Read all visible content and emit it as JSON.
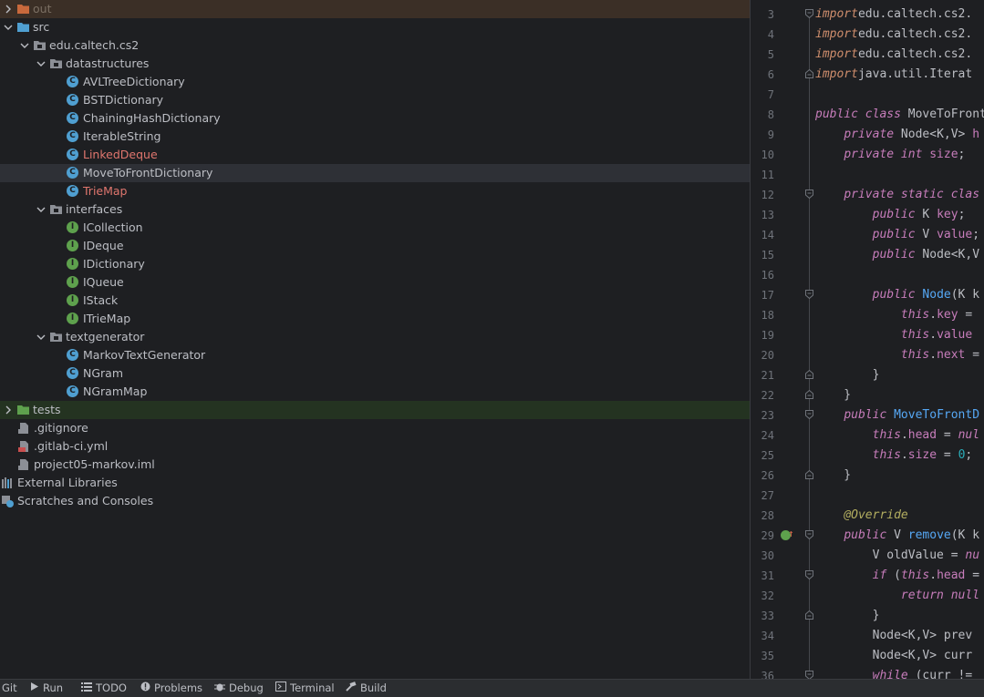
{
  "tree": {
    "items": [
      {
        "label": "out",
        "indent": 0,
        "kind": "folder-orange",
        "chevron": "right",
        "style": "muted",
        "highlight": "out"
      },
      {
        "label": "src",
        "indent": 0,
        "kind": "folder-blue",
        "chevron": "down"
      },
      {
        "label": "edu.caltech.cs2",
        "indent": 1,
        "kind": "package",
        "chevron": "down"
      },
      {
        "label": "datastructures",
        "indent": 2,
        "kind": "package",
        "chevron": "down"
      },
      {
        "label": "AVLTreeDictionary",
        "indent": 3,
        "kind": "class"
      },
      {
        "label": "BSTDictionary",
        "indent": 3,
        "kind": "class"
      },
      {
        "label": "ChainingHashDictionary",
        "indent": 3,
        "kind": "class"
      },
      {
        "label": "IterableString",
        "indent": 3,
        "kind": "class"
      },
      {
        "label": "LinkedDeque",
        "indent": 3,
        "kind": "class",
        "style": "red"
      },
      {
        "label": "MoveToFrontDictionary",
        "indent": 3,
        "kind": "class",
        "highlight": "sel"
      },
      {
        "label": "TrieMap",
        "indent": 3,
        "kind": "class",
        "style": "red"
      },
      {
        "label": "interfaces",
        "indent": 2,
        "kind": "package",
        "chevron": "down"
      },
      {
        "label": "ICollection",
        "indent": 3,
        "kind": "interface"
      },
      {
        "label": "IDeque",
        "indent": 3,
        "kind": "interface"
      },
      {
        "label": "IDictionary",
        "indent": 3,
        "kind": "interface"
      },
      {
        "label": "IQueue",
        "indent": 3,
        "kind": "interface"
      },
      {
        "label": "IStack",
        "indent": 3,
        "kind": "interface"
      },
      {
        "label": "ITrieMap",
        "indent": 3,
        "kind": "interface"
      },
      {
        "label": "textgenerator",
        "indent": 2,
        "kind": "package",
        "chevron": "down"
      },
      {
        "label": "MarkovTextGenerator",
        "indent": 3,
        "kind": "class-main"
      },
      {
        "label": "NGram",
        "indent": 3,
        "kind": "class"
      },
      {
        "label": "NGramMap",
        "indent": 3,
        "kind": "class"
      },
      {
        "label": "tests",
        "indent": 0,
        "kind": "folder-green",
        "chevron": "right",
        "highlight": "tests"
      },
      {
        "label": ".gitignore",
        "indent": 1,
        "kind": "file-git"
      },
      {
        "label": ".gitlab-ci.yml",
        "indent": 1,
        "kind": "file-yml"
      },
      {
        "label": "project05-markov.iml",
        "indent": 1,
        "kind": "file-iml"
      },
      {
        "label": "External Libraries",
        "indent": 0,
        "kind": "libraries",
        "flush": true
      },
      {
        "label": "Scratches and Consoles",
        "indent": 0,
        "kind": "scratches",
        "flush": true
      }
    ]
  },
  "editor": {
    "lines": [
      {
        "n": "3",
        "fold": "open",
        "html": [
          [
            "kwi",
            "import"
          ],
          [
            "",
            "edu.caltech.cs2."
          ]
        ]
      },
      {
        "n": "4",
        "html": [
          [
            "kwi",
            "import"
          ],
          [
            "",
            "edu.caltech.cs2."
          ]
        ]
      },
      {
        "n": "5",
        "html": [
          [
            "kwi",
            "import"
          ],
          [
            "",
            "edu.caltech.cs2."
          ]
        ]
      },
      {
        "n": "6",
        "fold": "close",
        "html": [
          [
            "kwi",
            "import"
          ],
          [
            "",
            "java.util.Iterat"
          ]
        ]
      },
      {
        "n": "7",
        "html": []
      },
      {
        "n": "8",
        "html": [
          [
            "kwp",
            "public class"
          ],
          [
            "",
            " MoveToFront"
          ]
        ]
      },
      {
        "n": "9",
        "html": [
          [
            "",
            "    "
          ],
          [
            "kwp",
            "private"
          ],
          [
            "",
            " Node<K,V> "
          ],
          [
            "fld",
            "h"
          ]
        ]
      },
      {
        "n": "10",
        "html": [
          [
            "",
            "    "
          ],
          [
            "kwp",
            "private int"
          ],
          [
            "",
            " "
          ],
          [
            "fld",
            "size"
          ],
          [
            "",
            ";"
          ]
        ]
      },
      {
        "n": "11",
        "html": []
      },
      {
        "n": "12",
        "fold": "open",
        "html": [
          [
            "",
            "    "
          ],
          [
            "kwp",
            "private static clas"
          ]
        ]
      },
      {
        "n": "13",
        "html": [
          [
            "",
            "        "
          ],
          [
            "kwp",
            "public"
          ],
          [
            "",
            " K "
          ],
          [
            "fld",
            "key"
          ],
          [
            "",
            ";"
          ]
        ]
      },
      {
        "n": "14",
        "html": [
          [
            "",
            "        "
          ],
          [
            "kwp",
            "public"
          ],
          [
            "",
            " V "
          ],
          [
            "fld",
            "value"
          ],
          [
            "",
            ";"
          ]
        ]
      },
      {
        "n": "15",
        "html": [
          [
            "",
            "        "
          ],
          [
            "kwp",
            "public"
          ],
          [
            "",
            " Node<K,V"
          ]
        ]
      },
      {
        "n": "16",
        "html": []
      },
      {
        "n": "17",
        "fold": "open",
        "html": [
          [
            "",
            "        "
          ],
          [
            "kwp",
            "public"
          ],
          [
            "",
            " "
          ],
          [
            "fn",
            "Node"
          ],
          [
            "",
            "(K k"
          ]
        ]
      },
      {
        "n": "18",
        "html": [
          [
            "",
            "            "
          ],
          [
            "kwp",
            "this"
          ],
          [
            "",
            "."
          ],
          [
            "fld",
            "key"
          ],
          [
            "",
            " ="
          ]
        ]
      },
      {
        "n": "19",
        "html": [
          [
            "",
            "            "
          ],
          [
            "kwp",
            "this"
          ],
          [
            "",
            "."
          ],
          [
            "fld",
            "value"
          ]
        ]
      },
      {
        "n": "20",
        "html": [
          [
            "",
            "            "
          ],
          [
            "kwp",
            "this"
          ],
          [
            "",
            "."
          ],
          [
            "fld",
            "next"
          ],
          [
            "",
            " ="
          ]
        ]
      },
      {
        "n": "21",
        "fold": "close",
        "html": [
          [
            "",
            "        }"
          ]
        ]
      },
      {
        "n": "22",
        "fold": "close",
        "html": [
          [
            "",
            "    }"
          ]
        ]
      },
      {
        "n": "23",
        "fold": "open",
        "html": [
          [
            "",
            "    "
          ],
          [
            "kwp",
            "public"
          ],
          [
            "",
            " "
          ],
          [
            "fn",
            "MoveToFrontD"
          ]
        ]
      },
      {
        "n": "24",
        "html": [
          [
            "",
            "        "
          ],
          [
            "kwp",
            "this"
          ],
          [
            "",
            "."
          ],
          [
            "fld",
            "head"
          ],
          [
            "",
            " = "
          ],
          [
            "kwp",
            "nul"
          ]
        ]
      },
      {
        "n": "25",
        "html": [
          [
            "",
            "        "
          ],
          [
            "kwp",
            "this"
          ],
          [
            "",
            "."
          ],
          [
            "fld",
            "size"
          ],
          [
            "",
            " = "
          ],
          [
            "num",
            "0"
          ],
          [
            "",
            ";"
          ]
        ]
      },
      {
        "n": "26",
        "fold": "close",
        "html": [
          [
            "",
            "    }"
          ]
        ]
      },
      {
        "n": "27",
        "html": []
      },
      {
        "n": "28",
        "html": [
          [
            "",
            "    "
          ],
          [
            "an",
            "@Override"
          ]
        ]
      },
      {
        "n": "29",
        "fold": "open",
        "marker": true,
        "html": [
          [
            "",
            "    "
          ],
          [
            "kwp",
            "public"
          ],
          [
            "",
            " V "
          ],
          [
            "fn",
            "remove"
          ],
          [
            "",
            "(K k"
          ]
        ]
      },
      {
        "n": "30",
        "html": [
          [
            "",
            "        V oldValue = "
          ],
          [
            "kwp",
            "nu"
          ]
        ]
      },
      {
        "n": "31",
        "fold": "open",
        "html": [
          [
            "",
            "        "
          ],
          [
            "kwp",
            "if"
          ],
          [
            "",
            " ("
          ],
          [
            "kwp",
            "this"
          ],
          [
            "",
            "."
          ],
          [
            "fld",
            "head"
          ],
          [
            "",
            " ="
          ]
        ]
      },
      {
        "n": "32",
        "html": [
          [
            "",
            "            "
          ],
          [
            "kwp",
            "return null"
          ]
        ]
      },
      {
        "n": "33",
        "fold": "close",
        "html": [
          [
            "",
            "        }"
          ]
        ]
      },
      {
        "n": "34",
        "html": [
          [
            "",
            "        Node<K,V> prev"
          ]
        ]
      },
      {
        "n": "35",
        "html": [
          [
            "",
            "        Node<K,V> curr"
          ]
        ]
      },
      {
        "n": "36",
        "fold": "open",
        "html": [
          [
            "",
            "        "
          ],
          [
            "kwp",
            "while"
          ],
          [
            "",
            " (curr != "
          ]
        ]
      }
    ]
  },
  "statusbar": {
    "items": [
      {
        "label": "Git",
        "icon": "none"
      },
      {
        "label": "Run",
        "icon": "run-icon"
      },
      {
        "label": "TODO",
        "icon": "todo-icon"
      },
      {
        "label": "Problems",
        "icon": "problems-icon"
      },
      {
        "label": "Debug",
        "icon": "debug-icon"
      },
      {
        "label": "Terminal",
        "icon": "terminal-icon"
      },
      {
        "label": "Build",
        "icon": "build-icon"
      }
    ]
  }
}
